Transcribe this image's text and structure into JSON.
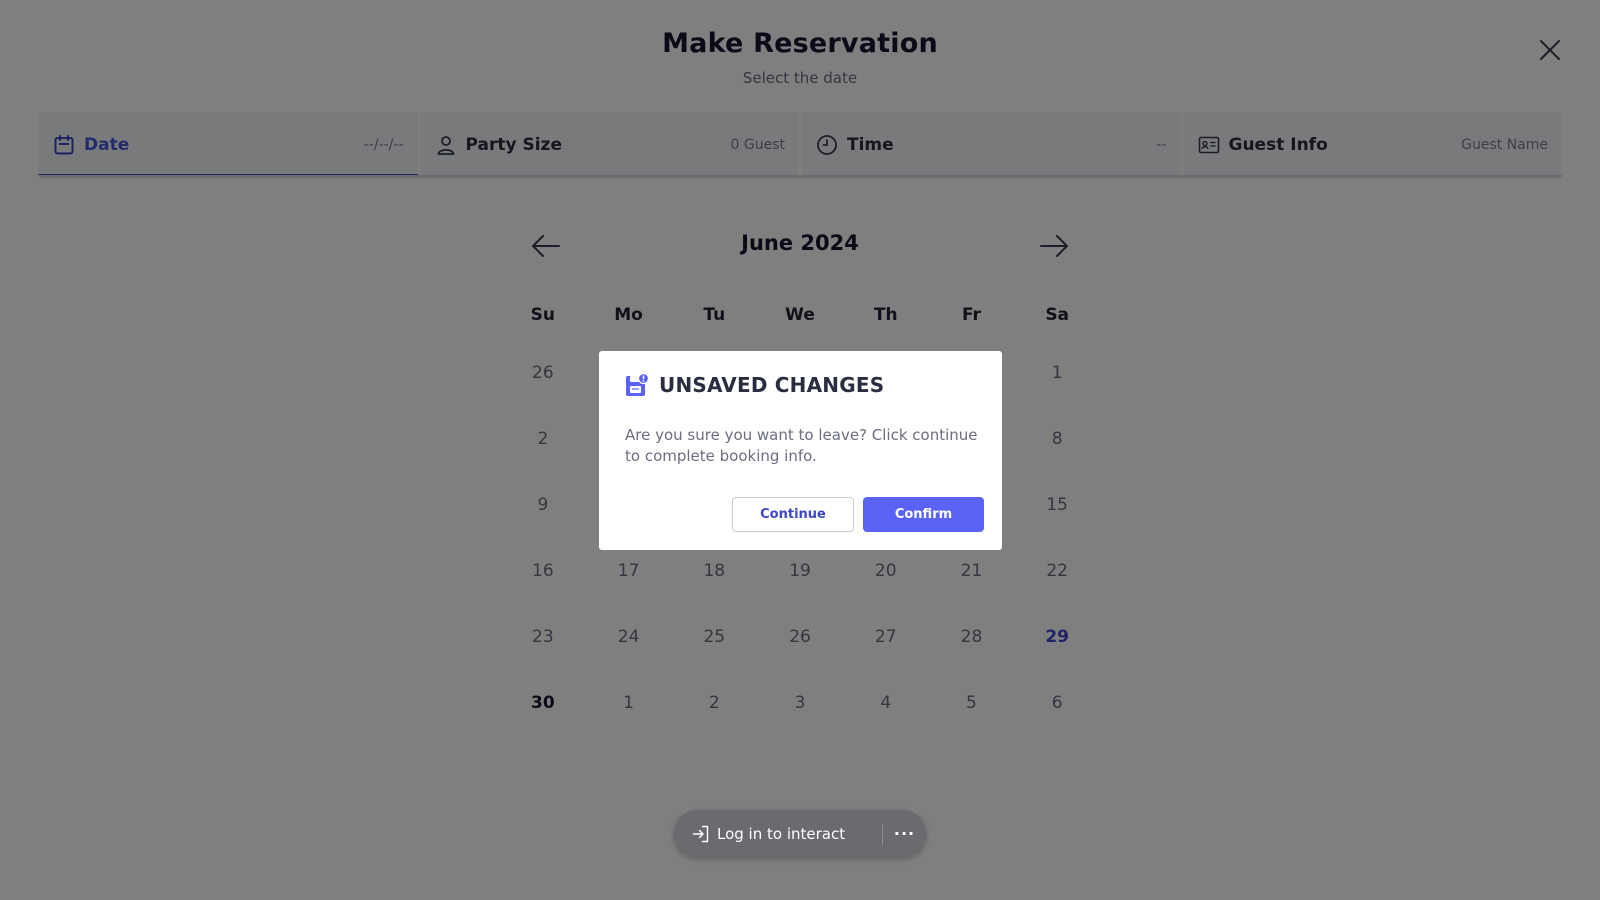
{
  "header": {
    "title": "Make Reservation",
    "subtitle": "Select the date"
  },
  "icons": {
    "close": "close-icon",
    "date": "calendar-icon",
    "party": "person-icon",
    "time": "clock-icon",
    "guest": "id-card-icon",
    "prev": "arrow-left-icon",
    "next": "arrow-right-icon",
    "modal": "save-alert-icon",
    "login": "sign-in-icon",
    "more": "more-dots-icon"
  },
  "steps": [
    {
      "label": "Date",
      "value": "--/--/--",
      "active": true
    },
    {
      "label": "Party Size",
      "value": "0 Guest",
      "active": false
    },
    {
      "label": "Time",
      "value": "--",
      "active": false
    },
    {
      "label": "Guest Info",
      "value": "Guest Name",
      "active": false
    }
  ],
  "calendar": {
    "month": "June 2024",
    "weekdays": [
      "Su",
      "Mo",
      "Tu",
      "We",
      "Th",
      "Fr",
      "Sa"
    ],
    "weeks": [
      [
        "26",
        "",
        "",
        "",
        "",
        "",
        "1"
      ],
      [
        "2",
        "",
        "",
        "",
        "",
        "",
        "8"
      ],
      [
        "9",
        "",
        "",
        "",
        "",
        "",
        "15"
      ],
      [
        "16",
        "17",
        "18",
        "19",
        "20",
        "21",
        "22"
      ],
      [
        "23",
        "24",
        "25",
        "26",
        "27",
        "28",
        "29"
      ],
      [
        "30",
        "1",
        "2",
        "3",
        "4",
        "5",
        "6"
      ]
    ],
    "highlighted_day": "29",
    "bold_day": "30"
  },
  "modal": {
    "title": "UNSAVED CHANGES",
    "message": "Are you sure you want to leave? Click continue to complete booking info.",
    "continue_label": "Continue",
    "confirm_label": "Confirm"
  },
  "login_pill": {
    "label": "Log in to interact",
    "more": "···"
  },
  "colors": {
    "accent": "#3d47c9",
    "confirm_button": "#5a63f6",
    "overlay": "rgba(0,0,0,0.5)"
  }
}
